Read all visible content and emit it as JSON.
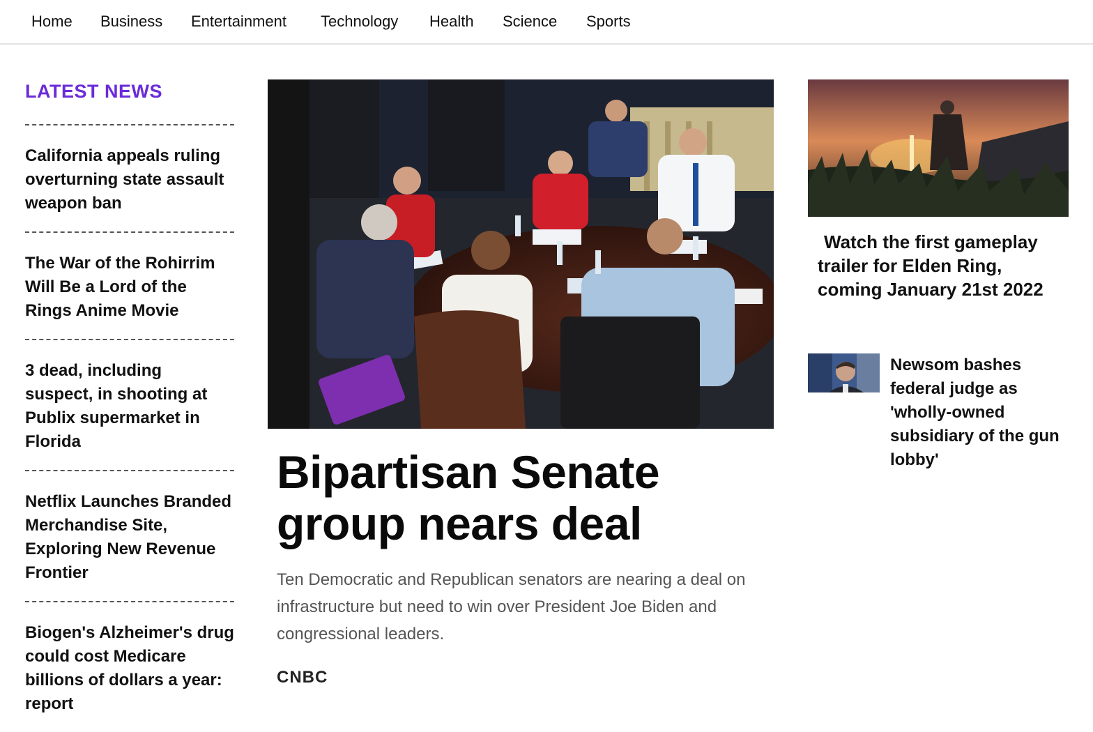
{
  "nav": {
    "items": [
      "Home",
      "Business",
      "Entertainment",
      "Technology",
      "Health",
      "Science",
      "Sports"
    ]
  },
  "latest": {
    "title": "LATEST NEWS",
    "items": [
      "California appeals ruling overturning state assault weapon ban",
      "The War of the Rohirrim Will Be a Lord of the Rings Anime Movie",
      "3 dead, including suspect, in shooting at Publix supermarket in Florida",
      "Netflix Launches Branded Merchandise Site, Exploring New Revenue Frontier",
      "Biogen's Alzheimer's drug could cost Medicare billions of dollars a year: report"
    ]
  },
  "feature": {
    "headline": "Bipartisan Senate group nears deal",
    "summary": "Ten Democratic and Republican senators are nearing a deal on infrastructure but need to win over President Joe Biden and congressional leaders.",
    "source": "CNBC"
  },
  "right": {
    "card_headline": "Watch the first gameplay trailer for Elden Ring, coming January 21st 2022",
    "side_headline": "Newsom bashes federal judge as 'wholly-owned subsidiary of the gun lobby'"
  },
  "colors": {
    "accent": "#6b2bd9",
    "text": "#111111",
    "muted": "#555555"
  }
}
